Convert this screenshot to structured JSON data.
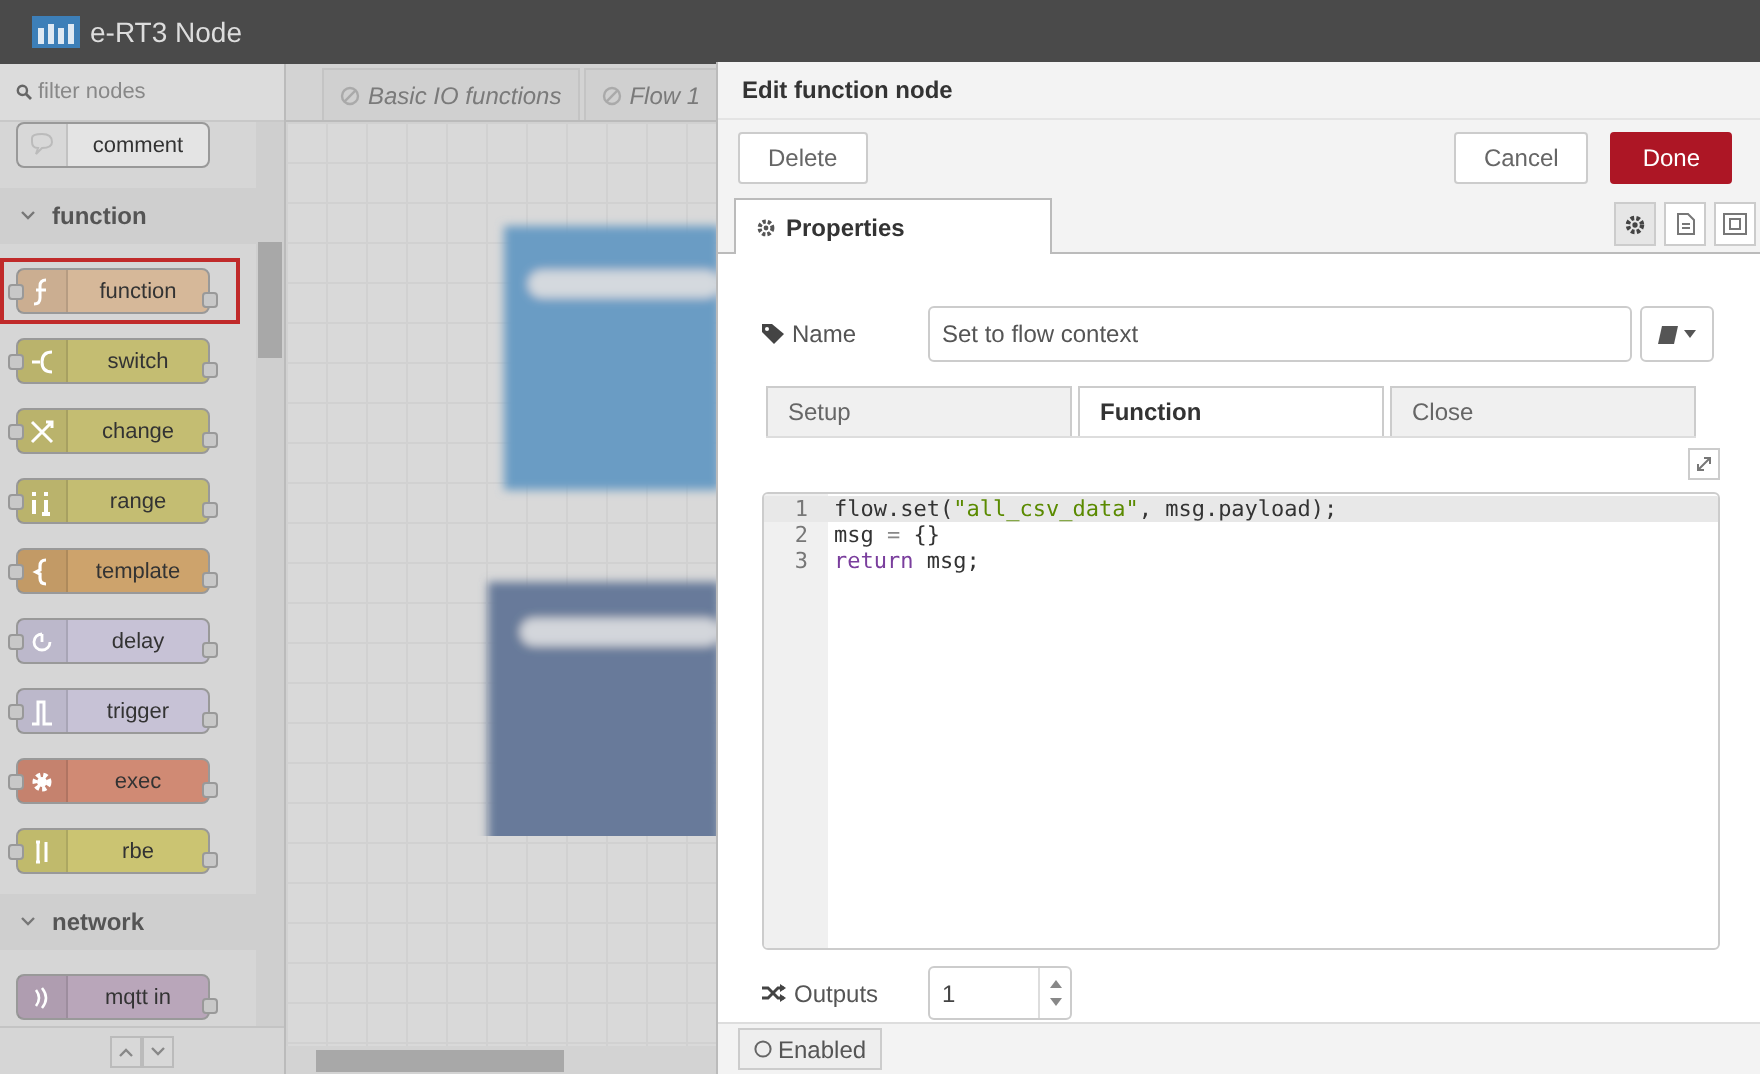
{
  "header": {
    "title": "e-RT3 Node"
  },
  "palette": {
    "filter_placeholder": "filter nodes",
    "items": [
      {
        "kind": "node",
        "label": "comment",
        "color": "#e4e4e4",
        "inputs": false,
        "outputs": false,
        "selected": false
      },
      {
        "kind": "category",
        "label": "function",
        "expanded": true
      },
      {
        "kind": "node",
        "label": "function",
        "color": "#d6b899",
        "inputs": true,
        "outputs": true,
        "selected": true
      },
      {
        "kind": "node",
        "label": "switch",
        "color": "#c4bd72",
        "inputs": true,
        "outputs": true,
        "selected": false
      },
      {
        "kind": "node",
        "label": "change",
        "color": "#c4bd72",
        "inputs": true,
        "outputs": true,
        "selected": false
      },
      {
        "kind": "node",
        "label": "range",
        "color": "#c4bd72",
        "inputs": true,
        "outputs": true,
        "selected": false
      },
      {
        "kind": "node",
        "label": "template",
        "color": "#cda36c",
        "inputs": true,
        "outputs": true,
        "selected": false
      },
      {
        "kind": "node",
        "label": "delay",
        "color": "#c7c2d6",
        "inputs": true,
        "outputs": true,
        "selected": false
      },
      {
        "kind": "node",
        "label": "trigger",
        "color": "#c7c2d6",
        "inputs": true,
        "outputs": true,
        "selected": false
      },
      {
        "kind": "node",
        "label": "exec",
        "color": "#d08a74",
        "inputs": true,
        "outputs": true,
        "selected": false
      },
      {
        "kind": "node",
        "label": "rbe",
        "color": "#cbc472",
        "inputs": true,
        "outputs": true,
        "selected": false
      },
      {
        "kind": "category",
        "label": "network",
        "expanded": true
      },
      {
        "kind": "node",
        "label": "mqtt in",
        "color": "#b9a6ba",
        "inputs": false,
        "outputs": true,
        "selected": false
      }
    ]
  },
  "workspace_tabs": [
    {
      "label": "Basic IO functions",
      "disabled": true
    },
    {
      "label": "Flow 1",
      "disabled": true
    }
  ],
  "tray": {
    "title": "Edit function node",
    "left_buttons": [
      {
        "label": "Delete",
        "primary": false
      }
    ],
    "right_buttons": [
      {
        "label": "Cancel",
        "primary": false
      },
      {
        "label": "Done",
        "primary": true
      }
    ],
    "tabs": [
      {
        "label": "Properties",
        "selected": true
      }
    ],
    "icon_tabs": [
      {
        "selected": true
      },
      {
        "selected": false
      },
      {
        "selected": false
      }
    ],
    "name": {
      "label": "Name",
      "value": "Set to flow context"
    },
    "function_tabs": [
      {
        "label": "Setup",
        "selected": false
      },
      {
        "label": "Function",
        "selected": true
      },
      {
        "label": "Close",
        "selected": false
      }
    ],
    "code": [
      {
        "number": "1",
        "active": true,
        "tokens": [
          {
            "text": "flow.set(",
            "kind": "plain"
          },
          {
            "text": "\"all_csv_data\"",
            "kind": "string"
          },
          {
            "text": ", msg.payload);",
            "kind": "plain"
          }
        ]
      },
      {
        "number": "2",
        "active": false,
        "tokens": [
          {
            "text": "msg ",
            "kind": "plain"
          },
          {
            "text": "=",
            "kind": "operator"
          },
          {
            "text": " {}",
            "kind": "plain"
          }
        ]
      },
      {
        "number": "3",
        "active": false,
        "tokens": [
          {
            "text": "return",
            "kind": "keyword"
          },
          {
            "text": " msg;",
            "kind": "plain"
          }
        ]
      }
    ],
    "outputs": {
      "label": "Outputs",
      "value": "1"
    },
    "footer": {
      "label": "Enabled"
    }
  }
}
